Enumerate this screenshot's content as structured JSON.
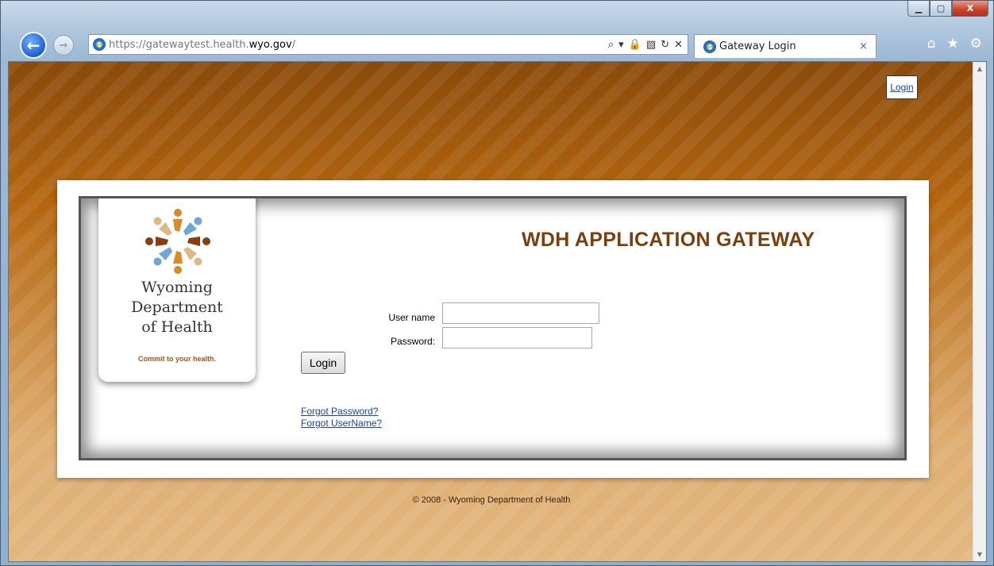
{
  "browser": {
    "url_prefix": "https://",
    "url_host": "gatewaytest.health.",
    "url_domain": "wyo.gov",
    "url_suffix": "/",
    "tab_title": "Gateway Login",
    "addr_tools": [
      "⌕",
      "▾",
      "🔒",
      "▧",
      "↻",
      "✕"
    ],
    "right_tools": [
      "⌂",
      "★",
      "⚙"
    ],
    "window_controls": [
      "▁",
      "▢",
      "X"
    ],
    "back_glyph": "←",
    "forward_glyph": "→",
    "tab_close": "×"
  },
  "page": {
    "top_login_link": "Login",
    "org_name": "Wyoming\nDepartment\nof Health",
    "tagline": "Commit to your health.",
    "title": "WDH APPLICATION GATEWAY",
    "form": {
      "username_label": "User name",
      "password_label": "Password:",
      "username_value": "",
      "password_value": "",
      "login_button": "Login"
    },
    "links": {
      "forgot_password": "Forgot Password?",
      "forgot_username": "Forgot UserName?"
    },
    "footer": "© 2008 - Wyoming Department of Health"
  },
  "colors": {
    "title_brown": "#7a3f0c",
    "tagline_orange": "#a3541a",
    "link_blue": "#1a3fbf"
  }
}
